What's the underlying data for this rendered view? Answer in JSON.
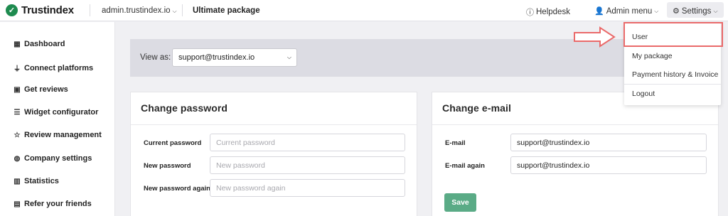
{
  "header": {
    "logo_text": "Trustindex",
    "domain": "admin.trustindex.io",
    "package": "Ultimate package",
    "helpdesk": "Helpdesk",
    "admin_menu": "Admin menu",
    "settings": "Settings"
  },
  "sidebar": {
    "items": [
      {
        "label": "Dashboard",
        "icon": "grid-icon"
      },
      {
        "label": "Connect platforms",
        "icon": "plug-icon"
      },
      {
        "label": "Get reviews",
        "icon": "chat-icon"
      },
      {
        "label": "Widget configurator",
        "icon": "sliders-icon"
      },
      {
        "label": "Review management",
        "icon": "star-icon"
      },
      {
        "label": "Company settings",
        "icon": "globe-icon"
      },
      {
        "label": "Statistics",
        "icon": "bar-chart-icon"
      },
      {
        "label": "Refer your friends",
        "icon": "gift-icon"
      }
    ]
  },
  "view_as": {
    "label": "View as:",
    "selected": "support@trustindex.io"
  },
  "change_password": {
    "title": "Change password",
    "fields": [
      {
        "label": "Current password",
        "placeholder": "Current password"
      },
      {
        "label": "New password",
        "placeholder": "New password"
      },
      {
        "label": "New password again",
        "placeholder": "New password again"
      }
    ]
  },
  "change_email": {
    "title": "Change e-mail",
    "fields": [
      {
        "label": "E-mail",
        "value": "support@trustindex.io"
      },
      {
        "label": "E-mail again",
        "value": "support@trustindex.io"
      }
    ],
    "save_label": "Save"
  },
  "settings_menu": {
    "items": [
      "User",
      "My package",
      "Payment history & Invoice",
      "Logout"
    ]
  },
  "colors": {
    "brand": "#1e8b4f",
    "save": "#5aab86",
    "highlight": "#ea6a6a"
  }
}
